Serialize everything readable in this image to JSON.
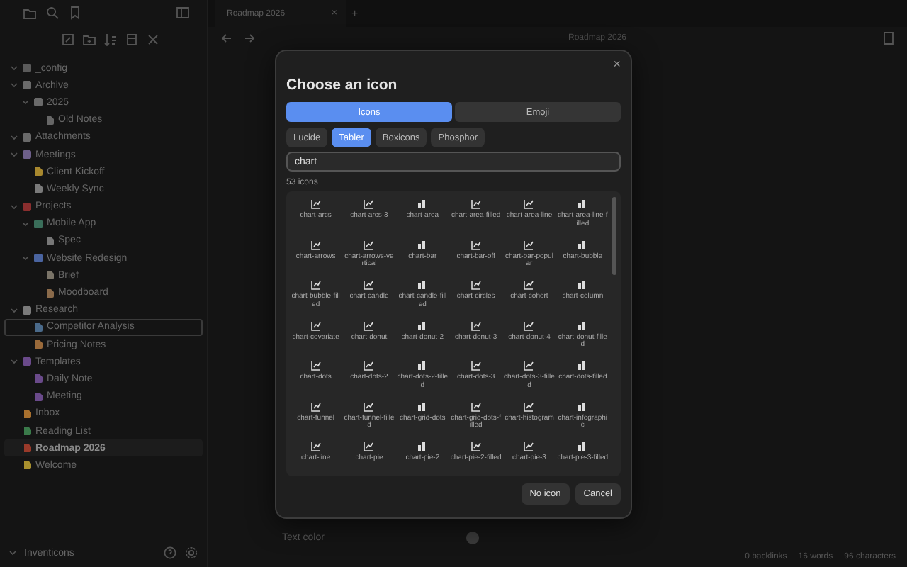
{
  "sidebar": {
    "tree": [
      {
        "label": "_config",
        "kind": "folder",
        "expanded": true,
        "selected": false,
        "focused": false,
        "color": "#5a5a5a"
      },
      {
        "label": "Archive",
        "kind": "folder",
        "expanded": true,
        "selected": false,
        "focused": false,
        "color": "#6a6a6a",
        "children": [
          {
            "label": "2025",
            "kind": "folder",
            "expanded": true,
            "selected": false,
            "focused": false,
            "color": "#6a6a6a",
            "children": [
              {
                "label": "Old Notes",
                "kind": "note",
                "selected": false,
                "focused": false,
                "color": "#666666"
              }
            ]
          }
        ]
      },
      {
        "label": "Attachments",
        "kind": "folder",
        "expanded": true,
        "selected": false,
        "focused": false,
        "color": "#6a6a6a"
      },
      {
        "label": "Meetings",
        "kind": "folder",
        "expanded": true,
        "selected": false,
        "focused": false,
        "color": "#6d5f8a",
        "children": [
          {
            "label": "Client Kickoff",
            "kind": "note",
            "selected": false,
            "focused": false,
            "color": "#a8882e"
          },
          {
            "label": "Weekly Sync",
            "kind": "note",
            "selected": false,
            "focused": false,
            "color": "#7a7a7a"
          }
        ]
      },
      {
        "label": "Projects",
        "kind": "folder",
        "expanded": true,
        "selected": false,
        "focused": false,
        "color": "#8a2e2e",
        "children": [
          {
            "label": "Mobile App",
            "kind": "folder",
            "expanded": true,
            "selected": false,
            "focused": false,
            "color": "#3a6e5a",
            "children": [
              {
                "label": "Spec",
                "kind": "note",
                "selected": false,
                "focused": false,
                "color": "#777777"
              }
            ]
          },
          {
            "label": "Website Redesign",
            "kind": "folder",
            "expanded": true,
            "selected": false,
            "focused": false,
            "color": "#4a64a0",
            "children": [
              {
                "label": "Brief",
                "kind": "note",
                "selected": false,
                "focused": false,
                "color": "#7a7468"
              },
              {
                "label": "Moodboard",
                "kind": "note",
                "selected": false,
                "focused": false,
                "color": "#8a6a4a"
              }
            ]
          }
        ]
      },
      {
        "label": "Research",
        "kind": "folder",
        "expanded": true,
        "selected": false,
        "focused": false,
        "color": "#7a7a7a",
        "children": [
          {
            "label": "Competitor Analysis",
            "kind": "note",
            "selected": false,
            "focused": true,
            "color": "#4a6a8a"
          },
          {
            "label": "Pricing Notes",
            "kind": "note",
            "selected": false,
            "focused": false,
            "color": "#9a6a3a"
          }
        ]
      },
      {
        "label": "Templates",
        "kind": "folder",
        "expanded": true,
        "selected": false,
        "focused": false,
        "color": "#6a4a8a",
        "children": [
          {
            "label": "Daily Note",
            "kind": "note",
            "selected": false,
            "focused": false,
            "color": "#6a4a8a"
          },
          {
            "label": "Meeting",
            "kind": "note",
            "selected": false,
            "focused": false,
            "color": "#6a4a8a"
          }
        ]
      },
      {
        "label": "Inbox",
        "kind": "note",
        "selected": false,
        "focused": false,
        "color": "#a8702e"
      },
      {
        "label": "Reading List",
        "kind": "note",
        "selected": false,
        "focused": false,
        "color": "#3a7a4a"
      },
      {
        "label": "Roadmap 2026",
        "kind": "note",
        "selected": true,
        "focused": false,
        "color": "#9a3a2a"
      },
      {
        "label": "Welcome",
        "kind": "note",
        "selected": false,
        "focused": false,
        "color": "#a8902e"
      }
    ],
    "vault": "Inventicons"
  },
  "editor": {
    "tab": "Roadmap 2026",
    "tab_close": "×",
    "new_tab": "+",
    "title": "Roadmap 2026",
    "field_label": "Text color"
  },
  "status_bar": {
    "backlinks": "0 backlinks",
    "words": "16 words",
    "characters": "96 characters"
  },
  "modal": {
    "title": "Choose an icon",
    "close": "×",
    "sources": [
      {
        "label": "Icons",
        "selected": true
      },
      {
        "label": "Emoji",
        "selected": false
      }
    ],
    "libraries": [
      {
        "label": "Lucide",
        "selected": false
      },
      {
        "label": "Tabler",
        "selected": true
      },
      {
        "label": "Boxicons",
        "selected": false
      },
      {
        "label": "Phosphor",
        "selected": false
      }
    ],
    "search": {
      "value": "chart"
    },
    "count": "53 icons",
    "icons": [
      "chart-arcs",
      "chart-arcs-3",
      "chart-area",
      "chart-area-filled",
      "chart-area-line",
      "chart-area-line-filled",
      "chart-arrows",
      "chart-arrows-vertical",
      "chart-bar",
      "chart-bar-off",
      "chart-bar-popular",
      "chart-bubble",
      "chart-bubble-filled",
      "chart-candle",
      "chart-candle-filled",
      "chart-circles",
      "chart-cohort",
      "chart-column",
      "chart-covariate",
      "chart-donut",
      "chart-donut-2",
      "chart-donut-3",
      "chart-donut-4",
      "chart-donut-filled",
      "chart-dots",
      "chart-dots-2",
      "chart-dots-2-filled",
      "chart-dots-3",
      "chart-dots-3-filled",
      "chart-dots-filled",
      "chart-funnel",
      "chart-funnel-filled",
      "chart-grid-dots",
      "chart-grid-dots-filled",
      "chart-histogram",
      "chart-infographic",
      "chart-line",
      "chart-pie",
      "chart-pie-2",
      "chart-pie-2-filled",
      "chart-pie-3",
      "chart-pie-3-filled"
    ],
    "buttons": [
      "No icon",
      "Cancel"
    ]
  }
}
